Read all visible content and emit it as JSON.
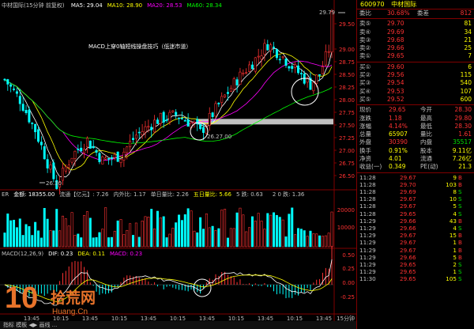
{
  "main_panel": {
    "stock_title": "中材国际(15分钟 前复权)",
    "ma_items": [
      {
        "label": "MA5: 29.04",
        "color": "#ffffff"
      },
      {
        "label": "MA10: 28.90",
        "color": "#ffff00"
      },
      {
        "label": "MA20: 28.53",
        "color": "#ff00ff"
      },
      {
        "label": "MA60: 28.34",
        "color": "#00ff00"
      }
    ],
    "annotation": "MACD上穿0轴短线操盘技巧（低迷市道）",
    "high_label": "29.79",
    "low_label": "26.30",
    "mid_label": "26.27.00",
    "price_axis": [
      "29.50",
      "29.00",
      "28.75",
      "28.50",
      "28.25",
      "28.00",
      "27.75",
      "27.50",
      "27.25",
      "27.00",
      "26.75",
      "26.50"
    ]
  },
  "volume_panel": {
    "header": [
      {
        "label": "ER",
        "color": "#c0c0c0"
      },
      {
        "label": "金额: 18355.00",
        "color": "#ffffff"
      },
      {
        "label": "流通【亿元】: 7.26",
        "color": "#c0c0c0"
      },
      {
        "label": "内外比: 1.17",
        "color": "#c0c0c0"
      },
      {
        "label": "单日量比: 2.26",
        "color": "#c0c0c0"
      },
      {
        "label": "五日量比: 5.66",
        "color": "#ffff00"
      },
      {
        "label": "5 跌: 0.63",
        "color": "#c0c0c0"
      },
      {
        "label": "",
        "color": "#0000ff"
      },
      {
        "label": "2 0 跌: 1.36",
        "color": "#c0c0c0"
      }
    ],
    "axis": [
      "20000",
      "10000"
    ]
  },
  "macd_panel": {
    "header": [
      {
        "label": "MACD(12,26,9)",
        "color": "#c0c0c0"
      },
      {
        "label": "DIF: 0.23",
        "color": "#ffffff"
      },
      {
        "label": "DEA: 0.11",
        "color": "#ffff00"
      },
      {
        "label": "MACD: 0.23",
        "color": "#ff00ff"
      }
    ],
    "axis": [
      "0.50",
      "0.25",
      "0.00",
      "-0.25"
    ]
  },
  "time_axis": [
    "13:45",
    "10:15",
    "13:45",
    "10:15",
    "13:45",
    "10:15",
    "13:45",
    "10:15",
    "13:45",
    "10:15",
    "13:45"
  ],
  "period_label": "15分钟",
  "bottom_bar": "指标 模板  ◀▶ 画线 ...",
  "watermark": {
    "num": "10",
    "cn": "拾荒网",
    "url": "Huang.Cn"
  },
  "quote": {
    "code": "600970",
    "name": "中材国际",
    "weibi_label": "委比",
    "weibi_value": "30.68%",
    "weicha_label": "委差",
    "weicha_value": "812",
    "asks": [
      {
        "label": "卖⑤",
        "price": "29.70",
        "vol": "81"
      },
      {
        "label": "卖④",
        "price": "29.69",
        "vol": "34"
      },
      {
        "label": "卖③",
        "price": "29.68",
        "vol": "21"
      },
      {
        "label": "卖②",
        "price": "29.66",
        "vol": "25"
      },
      {
        "label": "卖①",
        "price": "29.65",
        "vol": "7"
      }
    ],
    "bids": [
      {
        "label": "买①",
        "price": "29.60",
        "vol": "6"
      },
      {
        "label": "买②",
        "price": "29.56",
        "vol": "115"
      },
      {
        "label": "买③",
        "price": "29.54",
        "vol": "540"
      },
      {
        "label": "买④",
        "price": "29.53",
        "vol": "107"
      },
      {
        "label": "买⑤",
        "price": "29.52",
        "vol": "600"
      }
    ],
    "stats": [
      {
        "l1": "现价",
        "v1": "29.65",
        "l2": "今开",
        "v2": "28.30",
        "c1": "#ff3232",
        "c2": "#ff3232"
      },
      {
        "l1": "涨跌",
        "v1": "1.18",
        "l2": "最高",
        "v2": "29.80",
        "c1": "#ff3232",
        "c2": "#ff3232"
      },
      {
        "l1": "涨幅",
        "v1": "4.14%",
        "l2": "最低",
        "v2": "28.30",
        "c1": "#ff3232",
        "c2": "#ff3232"
      },
      {
        "l1": "总量",
        "v1": "65907",
        "l2": "量比",
        "v2": "1.61",
        "c1": "#ffff00",
        "c2": "#ff3232"
      },
      {
        "l1": "外盘",
        "v1": "30390",
        "l2": "内盘",
        "v2": "35517",
        "c1": "#ff3232",
        "c2": "#00e000"
      },
      {
        "l1": "换手",
        "v1": "0.91%",
        "l2": "股本",
        "v2": "9.11亿",
        "c1": "#ffff00",
        "c2": "#ffff00"
      },
      {
        "l1": "净资",
        "v1": "4.01",
        "l2": "流通",
        "v2": "7.26亿",
        "c1": "#ffff00",
        "c2": "#ffff00"
      },
      {
        "l1": "收益(一)",
        "v1": "0.349",
        "l2": "PE(动)",
        "v2": "21.3",
        "c1": "#ffff00",
        "c2": "#ffff00"
      }
    ],
    "ticks": [
      {
        "time": "11:28",
        "price": "29.67",
        "vol": "9",
        "dir": "B"
      },
      {
        "time": "11:28",
        "price": "29.70",
        "vol": "103",
        "dir": "B"
      },
      {
        "time": "11:28",
        "price": "29.69",
        "vol": "8",
        "dir": "S"
      },
      {
        "time": "11:28",
        "price": "29.67",
        "vol": "10",
        "dir": "S"
      },
      {
        "time": "11:28",
        "price": "29.67",
        "vol": "5",
        "dir": "S"
      },
      {
        "time": "11:28",
        "price": "29.65",
        "vol": "4",
        "dir": "S"
      },
      {
        "time": "11:29",
        "price": "29.66",
        "vol": "43",
        "dir": "B"
      },
      {
        "time": "11:29",
        "price": "29.66",
        "vol": "4",
        "dir": "S"
      },
      {
        "time": "11:29",
        "price": "29.67",
        "vol": "15",
        "dir": "B"
      },
      {
        "time": "11:29",
        "price": "29.67",
        "vol": "1",
        "dir": "B"
      },
      {
        "time": "11:29",
        "price": "29.67",
        "vol": "1",
        "dir": "B"
      },
      {
        "time": "11:29",
        "price": "29.66",
        "vol": "5",
        "dir": "B"
      },
      {
        "time": "11:29",
        "price": "29.65",
        "vol": "2",
        "dir": "S"
      },
      {
        "time": "11:29",
        "price": "29.65",
        "vol": "1",
        "dir": "S"
      },
      {
        "time": "11:30",
        "price": "29.65",
        "vol": "105",
        "dir": "S"
      }
    ]
  },
  "colors": {
    "up": "#ff3232",
    "down": "#00ffff",
    "ma5": "#ffffff",
    "ma10": "#ffff00",
    "ma20": "#ff00ff",
    "ma60": "#00ff00",
    "grid": "#800000"
  }
}
